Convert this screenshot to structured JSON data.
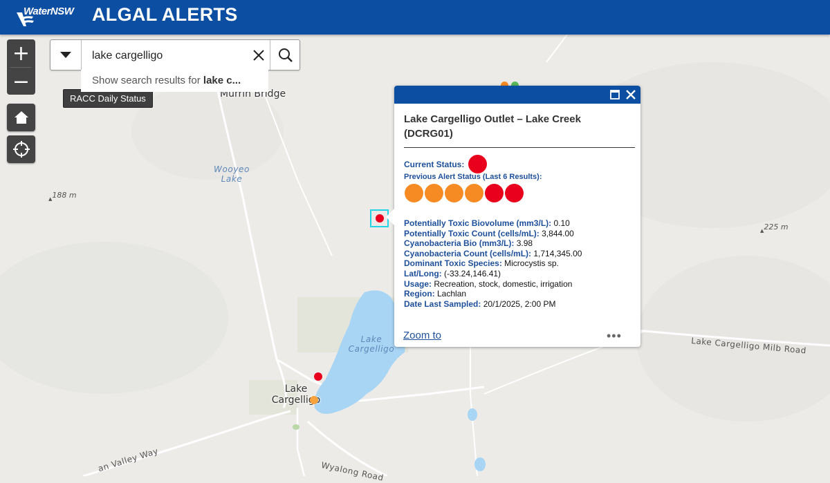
{
  "header": {
    "logo_text": "WaterNSW",
    "app_title": "ALGAL ALERTS"
  },
  "map_labels": {
    "murrin_bridge": "Murrin Bridge",
    "wooyeo_lake": "Wooyeo Lake",
    "elev_188": "188 m",
    "elev_225": "225 m",
    "lake_cargelligo_water": "Lake Cargelligo",
    "lake_cargelligo_town": "Lake Cargelligo",
    "road_milb": "Lake Cargelligo Milb Road",
    "road_valley": "an Valley Way",
    "road_wyalong": "Wyalong Road"
  },
  "controls": {
    "zoom_in": "+",
    "zoom_out": "−",
    "tooltip": "RACC Daily Status"
  },
  "search": {
    "value": "lake cargelligo",
    "suggestion_prefix": "Show search results for ",
    "suggestion_bold": "lake c...",
    "dropdown_icon": "chevron-down-icon",
    "clear_icon": "close-icon",
    "search_icon": "search-icon"
  },
  "colors": {
    "header_blue": "#0b4ea2",
    "label_blue": "#1d4f9b",
    "alert_red": "#e8001c",
    "alert_orange": "#f78b23",
    "alert_green": "#5cb85c",
    "highlight_cyan": "#22d3e6",
    "water": "#a9d5f5"
  },
  "popup": {
    "title": "Lake Cargelligo Outlet – Lake Creek (DCRG01)",
    "current_status_label": "Current Status:",
    "current_status": "red",
    "previous_label": "Previous Alert Status (Last 6 Results):",
    "previous_statuses": [
      "orange",
      "orange",
      "orange",
      "orange",
      "red",
      "red"
    ],
    "attributes": [
      {
        "label": "Potentially Toxic Biovolume (mm3/L):",
        "value": "0.10"
      },
      {
        "label": "Potentially Toxic Count (cells/mL):",
        "value": "3,844.00"
      },
      {
        "label": "Cyanobacteria  Bio (mm3/L):",
        "value": "3.98"
      },
      {
        "label": "Cyanobacteria Count (cells/mL):",
        "value": "1,714,345.00"
      },
      {
        "label": "Dominant Toxic Species:",
        "value": "Microcystis sp."
      },
      {
        "label": "Lat/Long:",
        "value": "(-33.24,146.41)"
      },
      {
        "label": "Usage:",
        "value": "Recreation, stock, domestic, irrigation"
      },
      {
        "label": "Region:",
        "value": "Lachlan"
      },
      {
        "label": "Date Last Sampled:",
        "value": "20/1/2025, 2:00 PM"
      }
    ],
    "zoom_to": "Zoom to",
    "more": "•••"
  }
}
